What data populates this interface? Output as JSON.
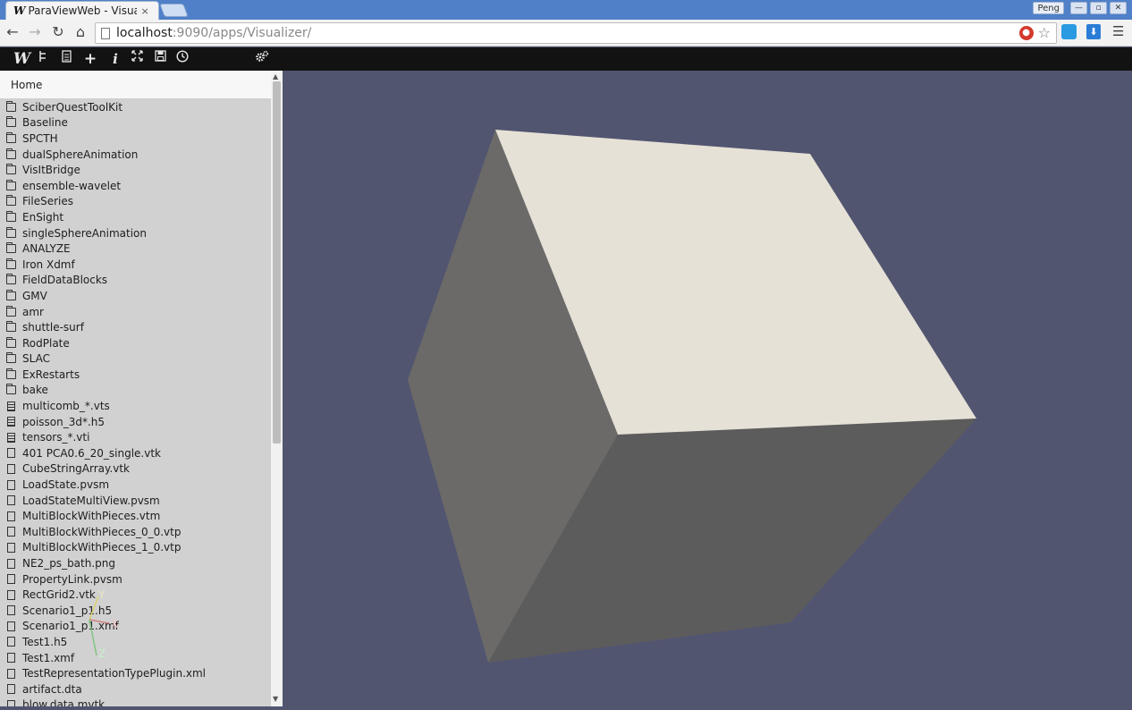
{
  "browser": {
    "tab_logo": "W",
    "tab_title": "ParaViewWeb - Visua",
    "tab_close": "×",
    "user": "Peng",
    "win_minimize": "—",
    "win_restore": "▫",
    "win_close": "✕",
    "url_host": "localhost",
    "url_path": ":9090/apps/Visualizer/"
  },
  "app_toolbar": {
    "logo": "W",
    "icons": [
      "pipeline-icon",
      "file-icon",
      "add-icon",
      "info-icon",
      "fullscreen-icon",
      "save-icon",
      "history-icon",
      "settings-icon"
    ]
  },
  "file_browser": {
    "home_label": "Home",
    "items": [
      {
        "type": "folder",
        "name": "SciberQuestToolKit"
      },
      {
        "type": "folder",
        "name": "Baseline"
      },
      {
        "type": "folder",
        "name": "SPCTH"
      },
      {
        "type": "folder",
        "name": "dualSphereAnimation"
      },
      {
        "type": "folder",
        "name": "VisItBridge"
      },
      {
        "type": "folder",
        "name": "ensemble-wavelet"
      },
      {
        "type": "folder",
        "name": "FileSeries"
      },
      {
        "type": "folder",
        "name": "EnSight"
      },
      {
        "type": "folder",
        "name": "singleSphereAnimation"
      },
      {
        "type": "folder",
        "name": "ANALYZE"
      },
      {
        "type": "folder",
        "name": "Iron Xdmf"
      },
      {
        "type": "folder",
        "name": "FieldDataBlocks"
      },
      {
        "type": "folder",
        "name": "GMV"
      },
      {
        "type": "folder",
        "name": "amr"
      },
      {
        "type": "folder",
        "name": "shuttle-surf"
      },
      {
        "type": "folder",
        "name": "RodPlate"
      },
      {
        "type": "folder",
        "name": "SLAC"
      },
      {
        "type": "folder",
        "name": "ExRestarts"
      },
      {
        "type": "folder",
        "name": "bake"
      },
      {
        "type": "group",
        "name": "multicomb_*.vts"
      },
      {
        "type": "group",
        "name": "poisson_3d*.h5"
      },
      {
        "type": "group",
        "name": "tensors_*.vti"
      },
      {
        "type": "file",
        "name": "401 PCA0.6_20_single.vtk"
      },
      {
        "type": "file",
        "name": "CubeStringArray.vtk"
      },
      {
        "type": "file",
        "name": "LoadState.pvsm"
      },
      {
        "type": "file",
        "name": "LoadStateMultiView.pvsm"
      },
      {
        "type": "file",
        "name": "MultiBlockWithPieces.vtm"
      },
      {
        "type": "file",
        "name": "MultiBlockWithPieces_0_0.vtp"
      },
      {
        "type": "file",
        "name": "MultiBlockWithPieces_1_0.vtp"
      },
      {
        "type": "file",
        "name": "NE2_ps_bath.png"
      },
      {
        "type": "file",
        "name": "PropertyLink.pvsm"
      },
      {
        "type": "file",
        "name": "RectGrid2.vtk"
      },
      {
        "type": "file",
        "name": "Scenario1_p1.h5"
      },
      {
        "type": "file",
        "name": "Scenario1_p1.xmf"
      },
      {
        "type": "file",
        "name": "Test1.h5"
      },
      {
        "type": "file",
        "name": "Test1.xmf"
      },
      {
        "type": "file",
        "name": "TestRepresentationTypePlugin.xml"
      },
      {
        "type": "file",
        "name": "artifact.dta"
      },
      {
        "type": "file",
        "name": "blow.data.mvtk"
      }
    ]
  },
  "viewport": {
    "background": "#525570",
    "cube_top_color": "#e6e1d6",
    "cube_left_color": "#6b6a68",
    "cube_front_color": "#5d5c5c",
    "axes": {
      "x": "X",
      "y": "Y",
      "z": "Z"
    }
  }
}
